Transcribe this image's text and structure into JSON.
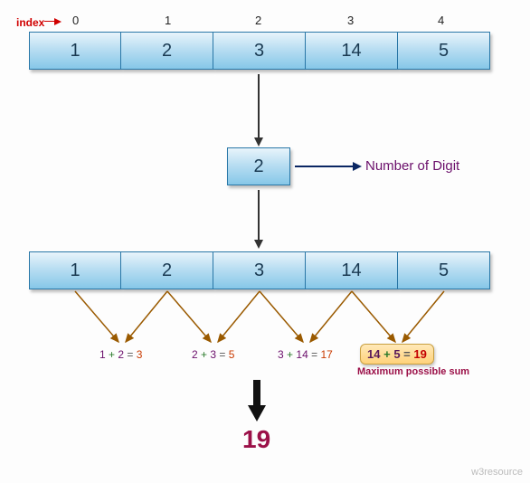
{
  "indexLabel": "index",
  "indices": [
    "0",
    "1",
    "2",
    "3",
    "4"
  ],
  "topArray": [
    "1",
    "2",
    "3",
    "14",
    "5"
  ],
  "digitValue": "2",
  "digitLabel": "Number of Digit",
  "bottomArray": [
    "1",
    "2",
    "3",
    "14",
    "5"
  ],
  "sums": [
    {
      "a": "1",
      "b": "2",
      "r": "3"
    },
    {
      "a": "2",
      "b": "3",
      "r": "5"
    },
    {
      "a": "3",
      "b": "14",
      "r": "17"
    }
  ],
  "badge": {
    "a": "14",
    "b": "5",
    "r": "19"
  },
  "maxLabel": "Maximum possible sum",
  "result": "19",
  "watermark": "w3resource"
}
